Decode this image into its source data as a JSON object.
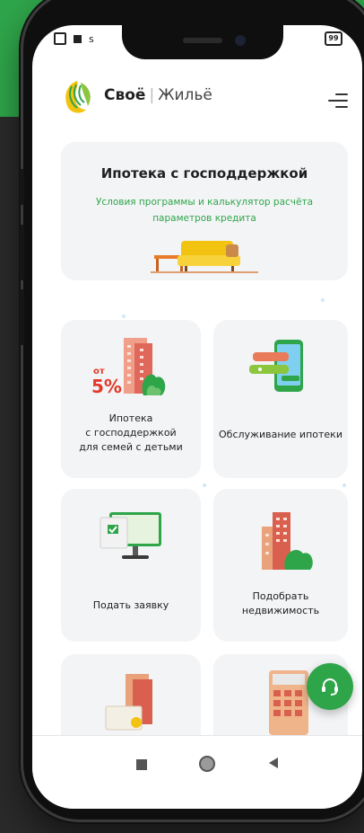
{
  "status_bar": {
    "battery": "99",
    "browser_tab_letter": "s"
  },
  "header": {
    "brand_bold": "Своё",
    "brand_thin": "Жильё"
  },
  "hero": {
    "title": "Ипотека с господдержкой",
    "subtitle_line1": "Условия программы и калькулятор расчёта",
    "subtitle_line2": "параметров кредита"
  },
  "tiles": [
    {
      "badge_prefix": "от",
      "badge_value": "5%",
      "label_line1": "Ипотека",
      "label_line2": "с господдержкой",
      "label_line3": "для семей с детьми"
    },
    {
      "label_line1": "Обслуживание ипотеки"
    },
    {
      "label_line1": "Подать заявку"
    },
    {
      "label_line1": "Подобрать",
      "label_line2": "недвижимость"
    }
  ],
  "colors": {
    "brand_green": "#2fa54a",
    "card_bg": "#f3f4f6",
    "dark_bg": "#2a2a2a"
  },
  "icons": {
    "menu": "hamburger-menu-icon",
    "support": "headset-icon",
    "nav_recent": "square-icon",
    "nav_home": "circle-icon",
    "nav_back": "triangle-back-icon"
  }
}
